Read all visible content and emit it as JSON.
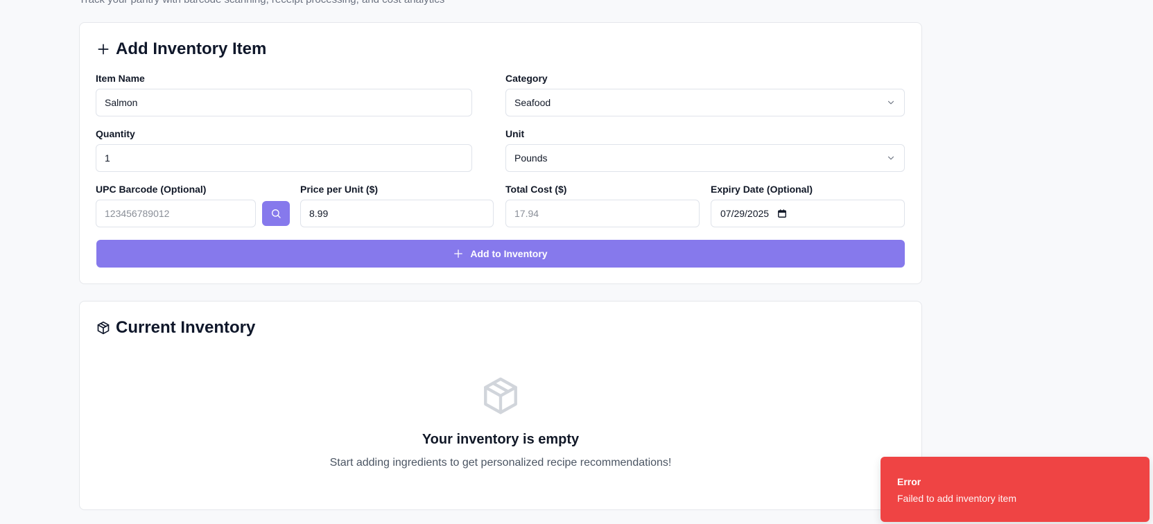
{
  "header": {
    "subtitle": "Track your pantry with barcode scanning, receipt processing, and cost analytics"
  },
  "add_card": {
    "title": "Add Inventory Item",
    "item_name": {
      "label": "Item Name",
      "value": "Salmon"
    },
    "category": {
      "label": "Category",
      "value": "Seafood"
    },
    "quantity": {
      "label": "Quantity",
      "value": "1"
    },
    "unit": {
      "label": "Unit",
      "value": "Pounds"
    },
    "upc": {
      "label": "UPC Barcode (Optional)",
      "placeholder": "123456789012"
    },
    "price": {
      "label": "Price per Unit ($)",
      "value": "8.99"
    },
    "total": {
      "label": "Total Cost ($)",
      "value": "17.94"
    },
    "expiry": {
      "label": "Expiry Date (Optional)",
      "value": "07/29/2025"
    },
    "submit_label": "Add to Inventory"
  },
  "inventory_card": {
    "title": "Current Inventory",
    "empty_title": "Your inventory is empty",
    "empty_subtitle": "Start adding ingredients to get personalized recipe recommendations!"
  },
  "toast": {
    "title": "Error",
    "message": "Failed to add inventory item"
  },
  "colors": {
    "accent": "#8679ec",
    "error": "#ef4444",
    "background": "#f8f9fb"
  },
  "icons": [
    "plus-icon",
    "chevron-down-icon",
    "search-icon",
    "calendar-icon",
    "package-icon"
  ]
}
